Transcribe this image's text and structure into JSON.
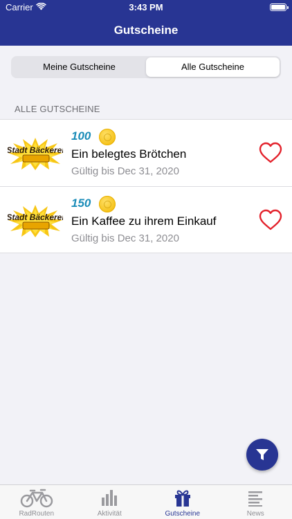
{
  "status_bar": {
    "carrier": "Carrier",
    "time": "3:43 PM"
  },
  "nav": {
    "title": "Gutscheine"
  },
  "segments": [
    {
      "label": "Meine Gutscheine",
      "selected": false
    },
    {
      "label": "Alle Gutscheine",
      "selected": true
    }
  ],
  "section": {
    "header": "ALLE GUTSCHEINE"
  },
  "vouchers": [
    {
      "points": "100",
      "title": "Ein belegtes Brötchen",
      "valid": "Gültig bis Dec 31, 2020",
      "logo_text": "Stadt Bäckerei"
    },
    {
      "points": "150",
      "title": "Ein Kaffee zu ihrem Einkauf",
      "valid": "Gültig bis Dec 31, 2020",
      "logo_text": "Stadt Bäckerei"
    }
  ],
  "tabs": [
    {
      "label": "RadRouten",
      "icon": "bicycle-icon"
    },
    {
      "label": "Aktivität",
      "icon": "bar-chart-icon"
    },
    {
      "label": "Gutscheine",
      "icon": "gift-icon",
      "active": true
    },
    {
      "label": "News",
      "icon": "news-lines-icon"
    }
  ],
  "colors": {
    "primary": "#283593",
    "points": "#1a8cb8",
    "heart": "#e3212b",
    "coin": "#f5c21b"
  }
}
